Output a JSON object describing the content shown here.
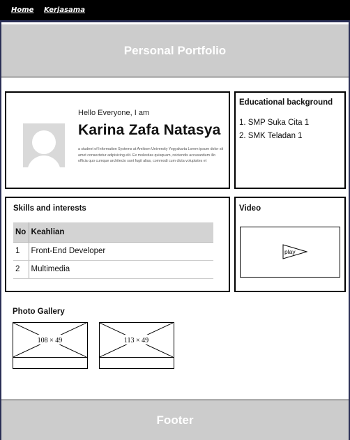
{
  "nav": {
    "home": "Home",
    "kerjasama": "Kerjasama"
  },
  "hero": {
    "title": "Personal Portfolio"
  },
  "intro": {
    "greeting": "Hello Everyone, I am",
    "name": "Karina Zafa Natasya",
    "description": "a student of Information Systems at Amikom University Yogyakarta Lorem ipsum dolor sit amet consectetur adipisicing elit. Ex molestias quisquam, reiciendis accusantium illo officia quo cumque architecto sunt fugit alias, commodi cum dicta voluptates et"
  },
  "education": {
    "title": "Educational background",
    "items": [
      "1. SMP Suka Cita 1",
      "2. SMK Teladan 1"
    ]
  },
  "skills": {
    "title": "Skills and interests",
    "headers": [
      "No",
      "Keahlian"
    ],
    "rows": [
      [
        "1",
        "Front-End Developer"
      ],
      [
        "2",
        "Multimedia"
      ]
    ]
  },
  "video": {
    "title": "Video",
    "play_label": "play"
  },
  "gallery": {
    "title": "Photo Gallery",
    "photos": [
      {
        "label": "108 × 49"
      },
      {
        "label": "113 × 49"
      }
    ]
  },
  "footer": {
    "text": "Footer"
  }
}
